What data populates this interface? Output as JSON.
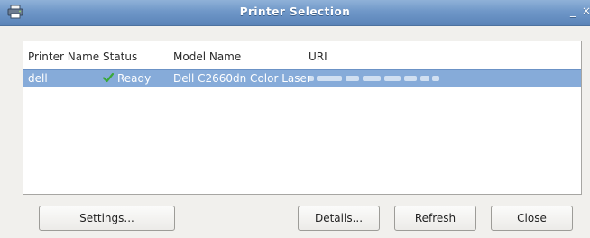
{
  "window": {
    "title": "Printer Selection",
    "minimize_glyph": "_",
    "close_glyph": "×",
    "title_icon": "printer-icon"
  },
  "table": {
    "columns": [
      "Printer Name",
      "Status",
      "Model Name",
      "URI"
    ],
    "rows": [
      {
        "printer_name": "dell",
        "status": "Ready",
        "status_icon": "checkmark-icon",
        "model_name": "Dell C2660dn Color Laser",
        "uri": "",
        "selected": true
      }
    ]
  },
  "buttons": {
    "settings": "Settings...",
    "details": "Details...",
    "refresh": "Refresh",
    "close": "Close"
  },
  "colors": {
    "titlebar": "#6f97c8",
    "selection": "#86abd9",
    "check": "#3aa83a"
  }
}
